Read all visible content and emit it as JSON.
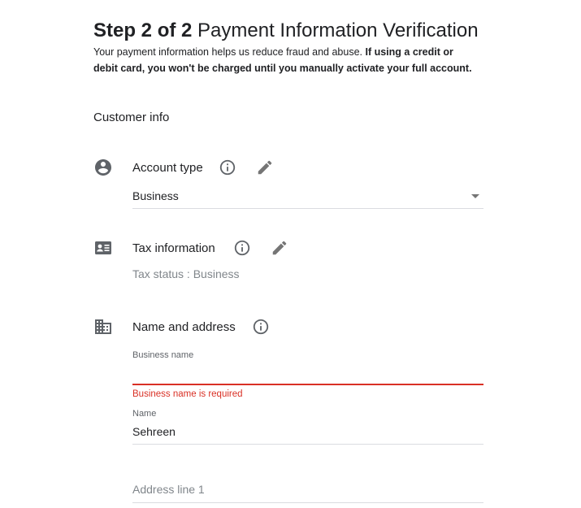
{
  "header": {
    "step": "Step 2 of 2",
    "title": "Payment Information Verification",
    "intro_normal": "Your payment information helps us reduce fraud and abuse. ",
    "intro_bold": "If using a credit or debit card, you won't be charged until you manually activate your full account."
  },
  "customer_info": {
    "section_title": "Customer info",
    "account_type": {
      "label": "Account type",
      "selected_value": "Business",
      "icon": "account-circle-icon"
    },
    "tax_information": {
      "label": "Tax information",
      "status_label": "Tax status",
      "status_separator": " : ",
      "status_value": "Business",
      "icon": "id-card-icon"
    },
    "name_and_address": {
      "label": "Name and address",
      "icon": "building-icon",
      "business_name": {
        "label": "Business name",
        "value": "",
        "error": "Business name is required"
      },
      "name": {
        "label": "Name",
        "value": "Sehreen"
      },
      "address_line_1": {
        "placeholder": "Address line 1",
        "value": ""
      }
    }
  },
  "colors": {
    "text": "#202124",
    "icon": "#5f6368",
    "muted": "#80868b",
    "divider": "#dadce0",
    "error": "#d93025"
  }
}
